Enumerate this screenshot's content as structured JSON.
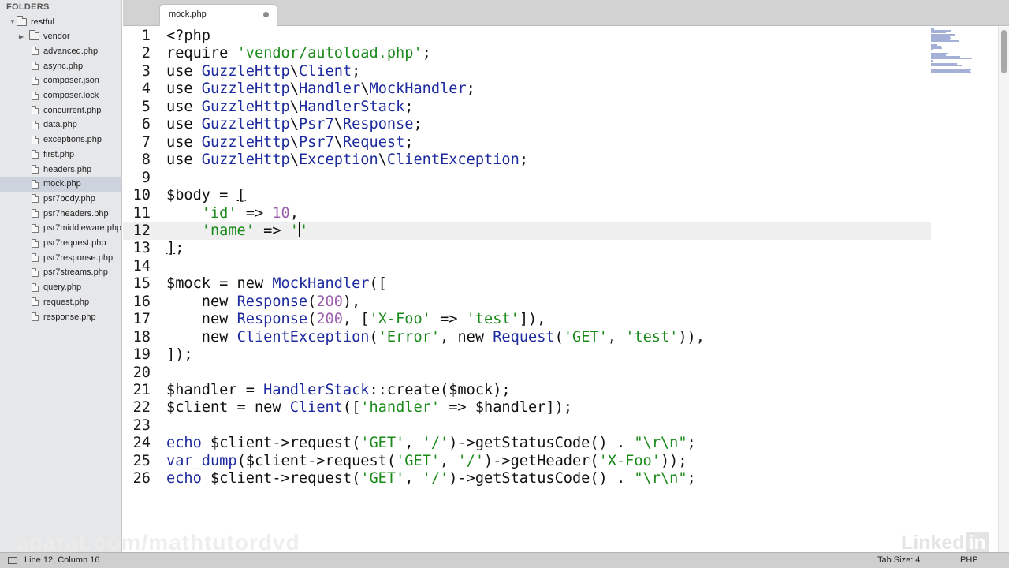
{
  "sidebar": {
    "header": "FOLDERS",
    "root": "restful",
    "items": [
      {
        "label": "vendor",
        "type": "folder"
      },
      {
        "label": "advanced.php",
        "type": "file"
      },
      {
        "label": "async.php",
        "type": "file"
      },
      {
        "label": "composer.json",
        "type": "file"
      },
      {
        "label": "composer.lock",
        "type": "file"
      },
      {
        "label": "concurrent.php",
        "type": "file"
      },
      {
        "label": "data.php",
        "type": "file"
      },
      {
        "label": "exceptions.php",
        "type": "file"
      },
      {
        "label": "first.php",
        "type": "file"
      },
      {
        "label": "headers.php",
        "type": "file"
      },
      {
        "label": "mock.php",
        "type": "file",
        "selected": true
      },
      {
        "label": "psr7body.php",
        "type": "file"
      },
      {
        "label": "psr7headers.php",
        "type": "file"
      },
      {
        "label": "psr7middleware.php",
        "type": "file"
      },
      {
        "label": "psr7request.php",
        "type": "file"
      },
      {
        "label": "psr7response.php",
        "type": "file"
      },
      {
        "label": "psr7streams.php",
        "type": "file"
      },
      {
        "label": "query.php",
        "type": "file"
      },
      {
        "label": "request.php",
        "type": "file"
      },
      {
        "label": "response.php",
        "type": "file"
      }
    ]
  },
  "tab": {
    "label": "mock.php",
    "modified": true
  },
  "editor": {
    "current_line": 12,
    "lines": [
      [
        [
          "t",
          "<?php"
        ]
      ],
      [
        [
          "t",
          "require "
        ],
        [
          "s",
          "'vendor/autoload.php'"
        ],
        [
          "t",
          ";"
        ]
      ],
      [
        [
          "t",
          "use "
        ],
        [
          "c",
          "GuzzleHttp"
        ],
        [
          "t",
          "\\"
        ],
        [
          "c",
          "Client"
        ],
        [
          "t",
          ";"
        ]
      ],
      [
        [
          "t",
          "use "
        ],
        [
          "c",
          "GuzzleHttp"
        ],
        [
          "t",
          "\\"
        ],
        [
          "c",
          "Handler"
        ],
        [
          "t",
          "\\"
        ],
        [
          "c",
          "MockHandler"
        ],
        [
          "t",
          ";"
        ]
      ],
      [
        [
          "t",
          "use "
        ],
        [
          "c",
          "GuzzleHttp"
        ],
        [
          "t",
          "\\"
        ],
        [
          "c",
          "HandlerStack"
        ],
        [
          "t",
          ";"
        ]
      ],
      [
        [
          "t",
          "use "
        ],
        [
          "c",
          "GuzzleHttp"
        ],
        [
          "t",
          "\\"
        ],
        [
          "c",
          "Psr7"
        ],
        [
          "t",
          "\\"
        ],
        [
          "c",
          "Response"
        ],
        [
          "t",
          ";"
        ]
      ],
      [
        [
          "t",
          "use "
        ],
        [
          "c",
          "GuzzleHttp"
        ],
        [
          "t",
          "\\"
        ],
        [
          "c",
          "Psr7"
        ],
        [
          "t",
          "\\"
        ],
        [
          "c",
          "Request"
        ],
        [
          "t",
          ";"
        ]
      ],
      [
        [
          "t",
          "use "
        ],
        [
          "c",
          "GuzzleHttp"
        ],
        [
          "t",
          "\\"
        ],
        [
          "c",
          "Exception"
        ],
        [
          "t",
          "\\"
        ],
        [
          "c",
          "ClientException"
        ],
        [
          "t",
          ";"
        ]
      ],
      [],
      [
        [
          "t",
          "$body = "
        ],
        [
          "u",
          "["
        ]
      ],
      [
        [
          "t",
          "    "
        ],
        [
          "s",
          "'id'"
        ],
        [
          "t",
          " => "
        ],
        [
          "n",
          "10"
        ],
        [
          "t",
          ","
        ]
      ],
      [
        [
          "t",
          "    "
        ],
        [
          "s",
          "'name'"
        ],
        [
          "t",
          " => "
        ],
        [
          "s",
          "'"
        ],
        [
          "caret",
          ""
        ],
        [
          "s",
          "'"
        ]
      ],
      [
        [
          "u",
          "]"
        ],
        [
          "t",
          ";"
        ]
      ],
      [],
      [
        [
          "t",
          "$mock = new "
        ],
        [
          "c",
          "MockHandler"
        ],
        [
          "t",
          "(["
        ]
      ],
      [
        [
          "t",
          "    new "
        ],
        [
          "c",
          "Response"
        ],
        [
          "t",
          "("
        ],
        [
          "n",
          "200"
        ],
        [
          "t",
          "),"
        ]
      ],
      [
        [
          "t",
          "    new "
        ],
        [
          "c",
          "Response"
        ],
        [
          "t",
          "("
        ],
        [
          "n",
          "200"
        ],
        [
          "t",
          ", ["
        ],
        [
          "s",
          "'X-Foo'"
        ],
        [
          "t",
          " => "
        ],
        [
          "s",
          "'test'"
        ],
        [
          "t",
          "]),"
        ]
      ],
      [
        [
          "t",
          "    new "
        ],
        [
          "c",
          "ClientException"
        ],
        [
          "t",
          "("
        ],
        [
          "s",
          "'Error'"
        ],
        [
          "t",
          ", new "
        ],
        [
          "c",
          "Request"
        ],
        [
          "t",
          "("
        ],
        [
          "s",
          "'GET'"
        ],
        [
          "t",
          ", "
        ],
        [
          "s",
          "'test'"
        ],
        [
          "t",
          ")),"
        ]
      ],
      [
        [
          "t",
          "]);"
        ]
      ],
      [],
      [
        [
          "t",
          "$handler = "
        ],
        [
          "c",
          "HandlerStack"
        ],
        [
          "t",
          "::create($mock);"
        ]
      ],
      [
        [
          "t",
          "$client = new "
        ],
        [
          "c",
          "Client"
        ],
        [
          "t",
          "(["
        ],
        [
          "s",
          "'handler'"
        ],
        [
          "t",
          " => $handler]);"
        ]
      ],
      [],
      [
        [
          "c",
          "echo"
        ],
        [
          "t",
          " $client->request("
        ],
        [
          "s",
          "'GET'"
        ],
        [
          "t",
          ", "
        ],
        [
          "s",
          "'/'"
        ],
        [
          "t",
          ")->getStatusCode() . "
        ],
        [
          "s",
          "\"\\r\\n\""
        ],
        [
          "t",
          ";"
        ]
      ],
      [
        [
          "c",
          "var_dump"
        ],
        [
          "t",
          "($client->request("
        ],
        [
          "s",
          "'GET'"
        ],
        [
          "t",
          ", "
        ],
        [
          "s",
          "'/'"
        ],
        [
          "t",
          ")->getHeader("
        ],
        [
          "s",
          "'X-Foo'"
        ],
        [
          "t",
          "));"
        ]
      ],
      [
        [
          "c",
          "echo"
        ],
        [
          "t",
          " $client->request("
        ],
        [
          "s",
          "'GET'"
        ],
        [
          "t",
          ", "
        ],
        [
          "s",
          "'/'"
        ],
        [
          "t",
          ")->getStatusCode() . "
        ],
        [
          "s",
          "\"\\r\\n\""
        ],
        [
          "t",
          ";"
        ]
      ]
    ]
  },
  "status": {
    "position": "Line 12, Column 16",
    "tab_size": "Tab Size: 4",
    "syntax": "PHP"
  },
  "watermarks": {
    "left": "aparat.com/mathtutordvd",
    "right": "Linked",
    "right_badge": "in"
  },
  "colors": {
    "string": "#1a8a1a",
    "number": "#9c5fb0",
    "class": "#1d2a9e",
    "current_line": "#efefef"
  }
}
